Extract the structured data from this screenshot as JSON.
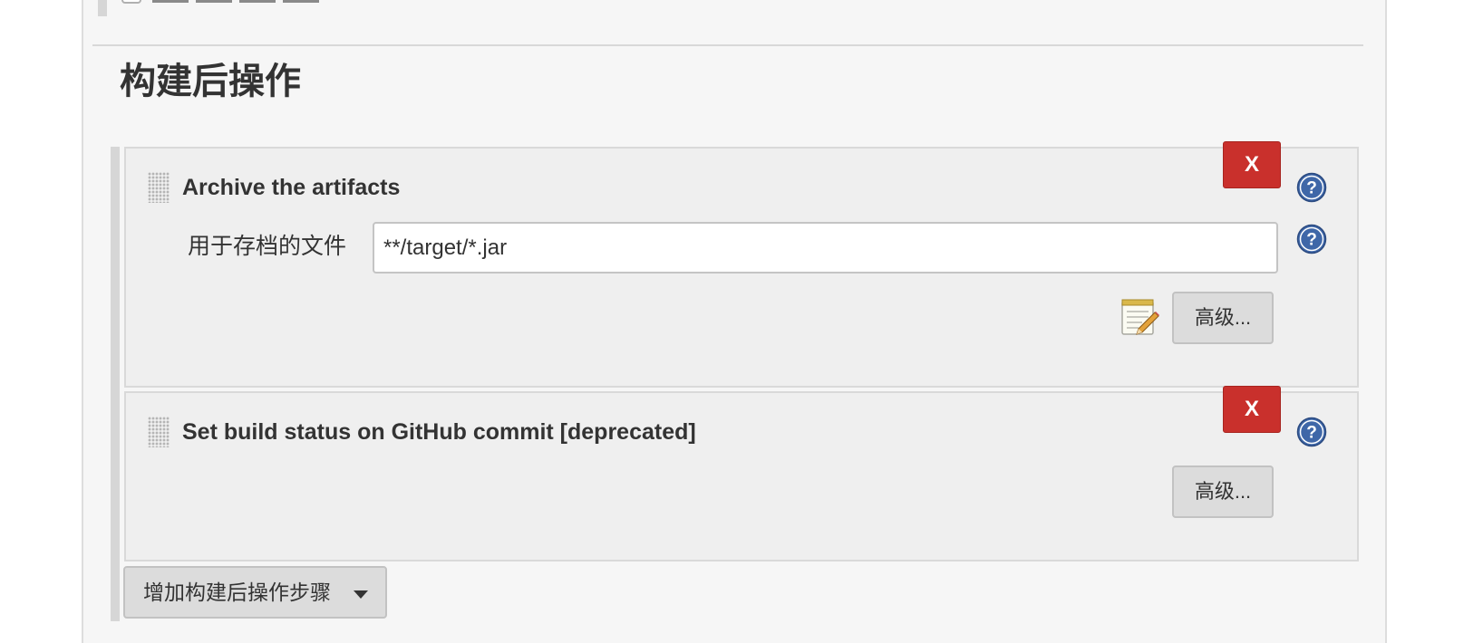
{
  "section": {
    "title": "构建后操作"
  },
  "steps": [
    {
      "title": "Archive the artifacts",
      "delete_label": "X",
      "fields": [
        {
          "label": "用于存档的文件",
          "value": "**/target/*.jar"
        }
      ],
      "advanced_label": "高级..."
    },
    {
      "title": "Set build status on GitHub commit [deprecated]",
      "delete_label": "X",
      "advanced_label": "高级..."
    }
  ],
  "add_step": {
    "label": "增加构建后操作步骤",
    "icon": "caret-down-icon"
  },
  "icons": {
    "help": "help-icon",
    "notepad": "notepad-edit-icon",
    "drag": "drag-handle-icon"
  },
  "colors": {
    "delete_button": "#c9302c",
    "help_icon": "#3f67a8",
    "panel_background": "#f6f6f6",
    "step_background": "#efefef"
  }
}
